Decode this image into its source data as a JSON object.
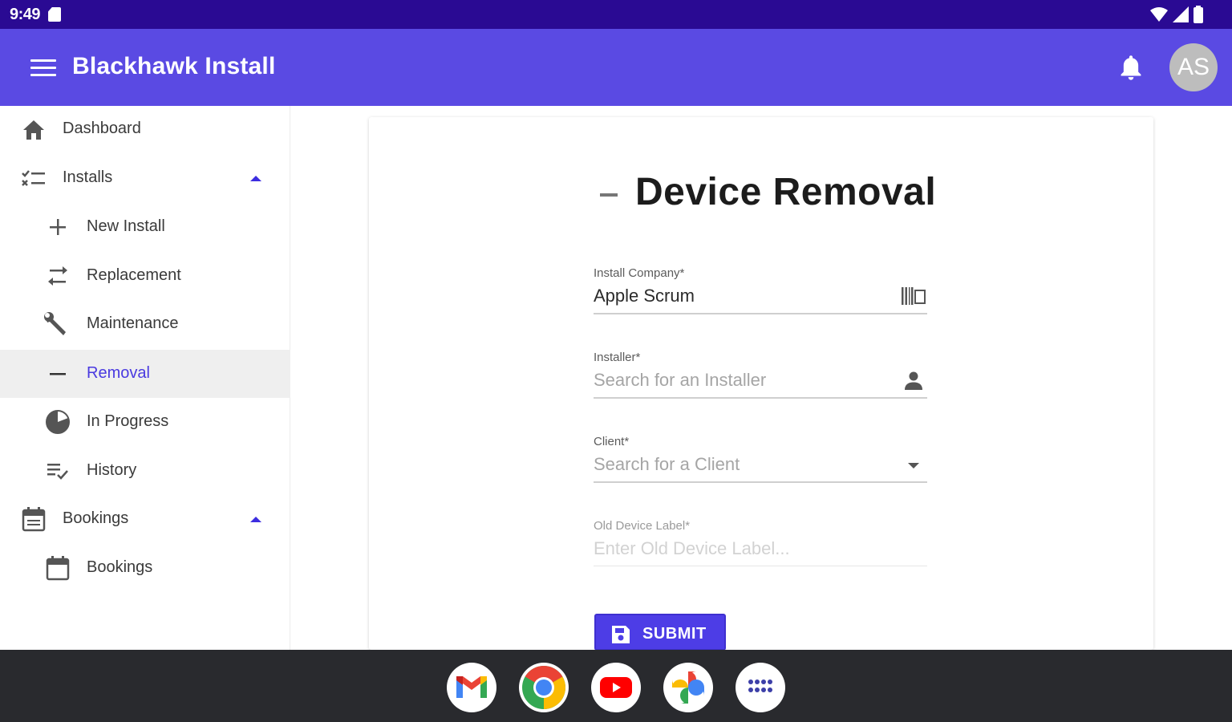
{
  "status_bar": {
    "time": "9:49"
  },
  "app_bar": {
    "title": "Blackhawk Install",
    "avatar_initials": "AS"
  },
  "sidebar": {
    "items": [
      {
        "label": "Dashboard",
        "icon": "home-icon"
      },
      {
        "label": "Installs",
        "icon": "checklist-icon",
        "expanded": true
      },
      {
        "label": "New Install",
        "icon": "plus-icon"
      },
      {
        "label": "Replacement",
        "icon": "swap-icon"
      },
      {
        "label": "Maintenance",
        "icon": "wrench-icon"
      },
      {
        "label": "Removal",
        "icon": "minus-icon",
        "active": true
      },
      {
        "label": "In Progress",
        "icon": "pie-icon"
      },
      {
        "label": "History",
        "icon": "history-list-icon"
      },
      {
        "label": "Bookings",
        "icon": "calendar-icon",
        "expanded": true
      },
      {
        "label": "Bookings",
        "icon": "calendar-icon"
      }
    ]
  },
  "form": {
    "title": "Device Removal",
    "install_company": {
      "label": "Install Company*",
      "value": "Apple Scrum"
    },
    "installer": {
      "label": "Installer*",
      "placeholder": "Search for an Installer"
    },
    "client": {
      "label": "Client*",
      "placeholder": "Search for a Client"
    },
    "old_device_label": {
      "label": "Old Device Label*",
      "placeholder": "Enter Old Device Label..."
    },
    "submit_label": "SUBMIT"
  },
  "taskbar": {
    "apps": [
      "gmail-icon",
      "chrome-icon",
      "youtube-icon",
      "photos-icon",
      "app-launcher-icon"
    ]
  },
  "colors": {
    "status_bar": "#2a0a93",
    "app_bar": "#5a4ae3",
    "accent": "#4d3de6",
    "active_row": "#efefef",
    "taskbar": "#292a2e"
  }
}
